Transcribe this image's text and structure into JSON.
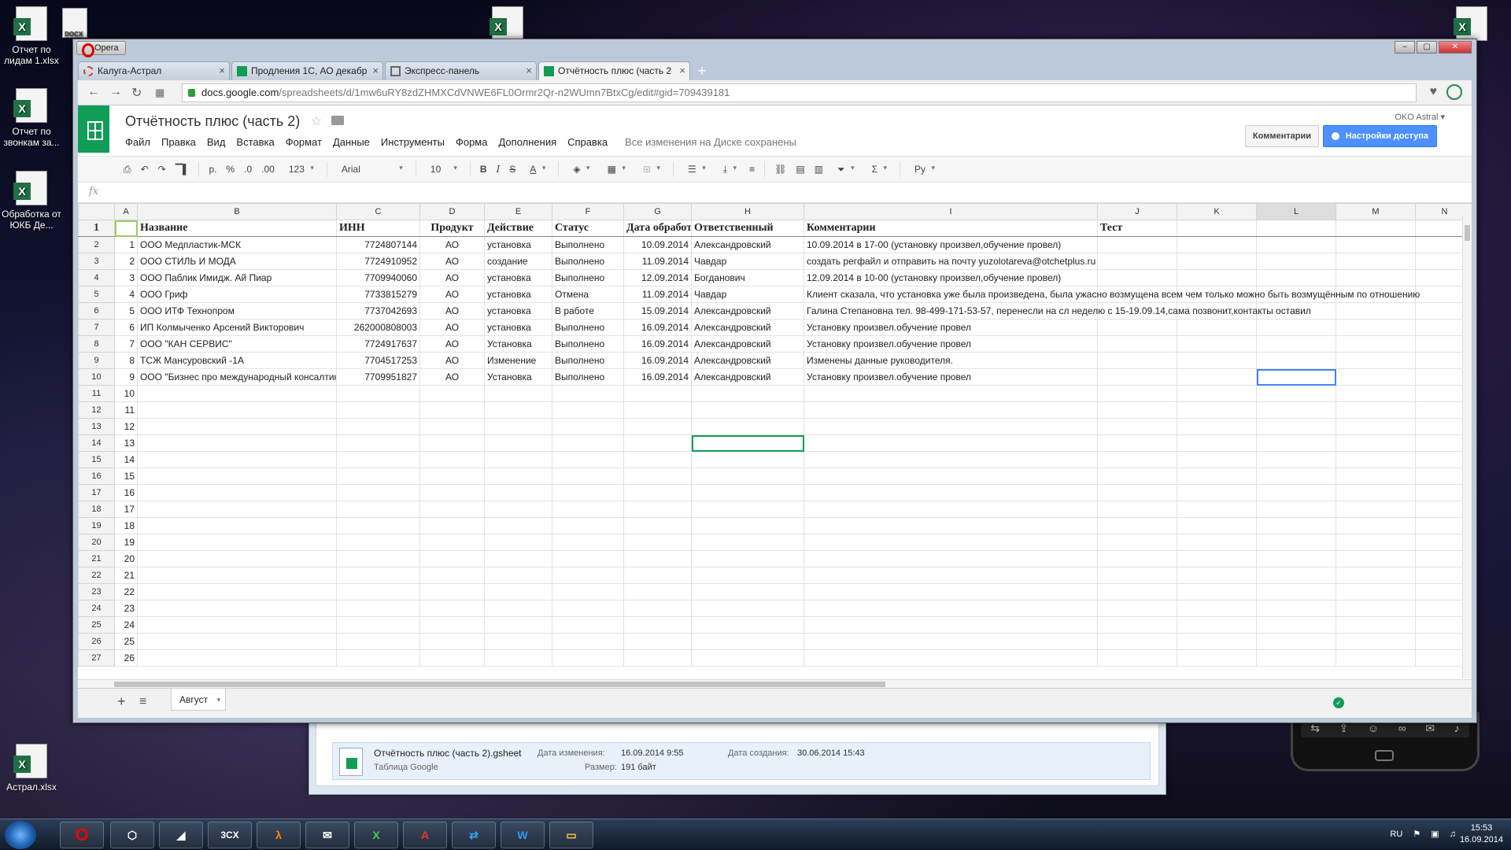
{
  "desktop_icons": [
    {
      "label": "Отчет по лидам 1.xlsx",
      "type": "xlsx"
    },
    {
      "label": "Отчет по звонкам за...",
      "type": "xlsx"
    },
    {
      "label": "Обработка от ЮКБ Де...",
      "type": "xlsx"
    },
    {
      "label": "Астрал.xlsx",
      "type": "xlsx"
    },
    {
      "label": "DOCX",
      "type": "docx"
    }
  ],
  "browser": {
    "menu_button": "Opera",
    "tabs": [
      {
        "label": "Калуга-Астрал",
        "icon": "globe-icon"
      },
      {
        "label": "Продления 1С, АО декабр",
        "icon": "sheets-icon"
      },
      {
        "label": "Экспресс-панель",
        "icon": "grid-icon"
      },
      {
        "label": "Отчётность плюс (часть 2",
        "icon": "sheets-icon"
      }
    ],
    "active_tab": 3,
    "url_host": "docs.google.com",
    "url_path": "/spreadsheets/d/1mw6uRY8zdZHMXCdVNWE6FL0Ormr2Qr-n2WUmn7BtxCg/edit#gid=709439181"
  },
  "doc": {
    "title": "Отчётность плюс (часть 2)",
    "menu": [
      "Файл",
      "Правка",
      "Вид",
      "Вставка",
      "Формат",
      "Данные",
      "Инструменты",
      "Форма",
      "Дополнения",
      "Справка"
    ],
    "saved_status": "Все изменения на Диске сохранены",
    "user": "OKO Astral",
    "comments_button": "Комментарии",
    "share_button": "Настройки доступа"
  },
  "toolbar": {
    "currency": "р.",
    "percent": "%",
    "dec_less": ".0",
    "dec_more": ".00",
    "format": "123",
    "font": "Arial",
    "size": "10",
    "input_lang": "Ру"
  },
  "formula_bar": {
    "label": "fx",
    "value": ""
  },
  "columns": [
    "A",
    "B",
    "C",
    "D",
    "E",
    "F",
    "G",
    "H",
    "I",
    "J",
    "K",
    "L",
    "M",
    "N"
  ],
  "selected_column": "L",
  "header_row": [
    "",
    "Название",
    "ИНН",
    "Продукт",
    "Действие",
    "Статус",
    "Дата обработки",
    "Ответственный",
    "Комментарии",
    "Тест"
  ],
  "rows": [
    [
      "1",
      "ООО Медпластик-МСК",
      "7724807144",
      "АО",
      "установка",
      "Выполнено",
      "10.09.2014",
      "Александровский",
      "10.09.2014 в 17-00 (установку произвел,обучение провел)"
    ],
    [
      "2",
      "ООО СТИЛЬ И МОДА",
      "7724910952",
      "АО",
      "создание",
      "Выполнено",
      "11.09.2014",
      "Чавдар",
      "создать регфайл и отправить на почту yuzolotareva@otchetplus.ru"
    ],
    [
      "3",
      "ООО Паблик Имидж. Ай Пиар",
      "7709940060",
      "АО",
      "установка",
      "Выполнено",
      "12.09.2014",
      "Богданович",
      "12.09.2014 в 10-00 (установку произвел,обучение провел)"
    ],
    [
      "4",
      "ООО Гриф",
      "7733815279",
      "АО",
      "установка",
      "Отмена",
      "11.09.2014",
      "Чавдар",
      "Клиент сказала, что установка уже была произведена, была ужасно возмущена всем чем только можно быть возмущённым по отношению"
    ],
    [
      "5",
      "ООО ИТФ Технопром",
      "7737042693",
      "АО",
      "установка",
      "В работе",
      "15.09.2014",
      "Александровский",
      "Галина Степановна тел. 98-499-171-53-57, перенесли на сл неделю с 15-19.09.14,сама позвонит,контакты оставил"
    ],
    [
      "6",
      "ИП Колмыченко Арсений Викторович",
      "262000808003",
      "АО",
      "установка",
      "Выполнено",
      "16.09.2014",
      "Александровский",
      "Установку произвел.обучение провел"
    ],
    [
      "7",
      "ООО \"КАН СЕРВИС\"",
      "7724917637",
      "АО",
      "Установка",
      "Выполнено",
      "16.09.2014",
      "Александровский",
      "Установку произвел.обучение провел"
    ],
    [
      "8",
      "ТСЖ Мансуровский -1А",
      "7704517253",
      "АО",
      "Изменение",
      "Выполнено",
      "16.09.2014",
      "Александровский",
      "Изменены данные руководителя."
    ],
    [
      "9",
      "ООО \"Бизнес про международный консалтинг\"",
      "7709951827",
      "АО",
      "Установка",
      "Выполнено",
      "16.09.2014",
      "Александровский",
      "Установку произвел.обучение провел"
    ]
  ],
  "empty_row_numbers": [
    "10",
    "11",
    "12",
    "13",
    "14",
    "15",
    "16",
    "17",
    "18",
    "19",
    "20",
    "21",
    "22",
    "23",
    "24",
    "25",
    "26"
  ],
  "visible_row_numbers": [
    "1",
    "2",
    "3",
    "4",
    "5",
    "6",
    "7",
    "8",
    "9",
    "10",
    "11",
    "12",
    "13",
    "14",
    "15",
    "16",
    "17",
    "18",
    "19",
    "20",
    "21",
    "22",
    "23",
    "24",
    "25",
    "26",
    "27"
  ],
  "sheet_tab": "Август",
  "explorer_detail": {
    "file_name": "Отчётность плюс (часть 2).gsheet",
    "file_type": "Таблица Google",
    "modified_label": "Дата изменения:",
    "modified_value": "16.09.2014 9:55",
    "created_label": "Дата создания:",
    "created_value": "30.06.2014 15:43",
    "size_label": "Размер:",
    "size_value": "191 байт"
  },
  "taskbar": {
    "apps": [
      "opera",
      "virtualbox",
      "eraser",
      "3CX",
      "half-life",
      "thunderbird",
      "excel",
      "acrobat",
      "teamviewer",
      "word",
      "explorer"
    ],
    "app_3cx_label": "3CX",
    "lang": "RU",
    "time": "15:53",
    "date": "16.09.2014"
  },
  "colors": {
    "sheets_green": "#0f9d58",
    "share_blue": "#4d90fe",
    "selection_blue": "#4285f4"
  }
}
